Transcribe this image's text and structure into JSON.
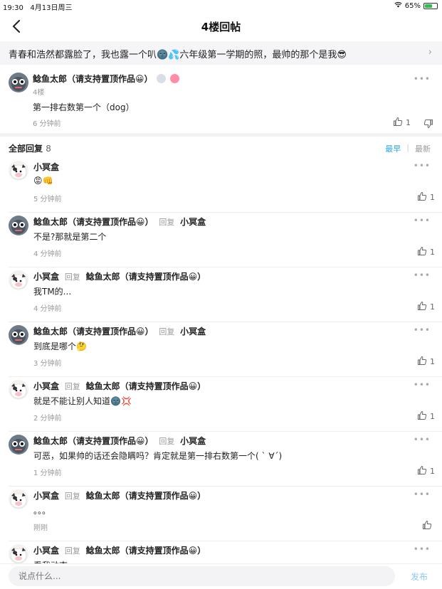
{
  "status": {
    "time": "19:30",
    "date": "4月13日周三",
    "battery_percent": "65%",
    "battery_level": 0.65
  },
  "nav": {
    "title": "4楼回帖"
  },
  "topic": {
    "text": "青春和浩然都露脸了，我也露一个叭🌚💦六年级第一学期的照，最帅的那个是我😎"
  },
  "post": {
    "author": "鲶鱼太郎（请支持置顶作品😀）",
    "floor": "4楼",
    "body": "第一排右数第一个（dog）",
    "time": "6 分钟前",
    "likes": "1"
  },
  "replies_header": {
    "title": "全部回复",
    "count": "8",
    "sort_earliest": "最早",
    "sort_latest": "最新"
  },
  "reply_word": "回复",
  "replies": [
    {
      "author": "小冥盒",
      "target": "",
      "text": "😡👊",
      "time": "5 分钟前",
      "likes": "1",
      "avatar": "cow"
    },
    {
      "author": "鲶鱼太郎（请支持置顶作品😀）",
      "target": "小冥盒",
      "text": "不是?那就是第二个",
      "time": "4 分钟前",
      "likes": "1",
      "avatar": "gray"
    },
    {
      "author": "小冥盒",
      "target": "鲶鱼太郎（请支持置顶作品😀）",
      "text": "我TM的...",
      "time": "4 分钟前",
      "likes": "1",
      "avatar": "cow"
    },
    {
      "author": "鲶鱼太郎（请支持置顶作品😀）",
      "target": "小冥盒",
      "text": "到底是哪个🤔",
      "time": "3 分钟前",
      "likes": "1",
      "avatar": "gray"
    },
    {
      "author": "小冥盒",
      "target": "鲶鱼太郎（请支持置顶作品😀）",
      "text": "就是不能让别人知道🌚💢",
      "time": "2 分钟前",
      "likes": "1",
      "avatar": "cow"
    },
    {
      "author": "鲶鱼太郎（请支持置顶作品😀）",
      "target": "小冥盒",
      "text": "可恶，如果帅的话还会隐瞒吗？肯定就是第一排右数第一个( ` ∀´)",
      "time": "1 分钟前",
      "likes": "1",
      "avatar": "gray"
    },
    {
      "author": "小冥盒",
      "target": "鲶鱼太郎（请支持置顶作品😀）",
      "text": "。。。",
      "time": "刚刚",
      "likes": "",
      "avatar": "cow"
    },
    {
      "author": "小冥盒",
      "target": "鲶鱼太郎（请支持置顶作品😀）",
      "text": "看我动态",
      "time": "",
      "likes": "",
      "avatar": "cow"
    }
  ],
  "bottom": {
    "placeholder": "说点什么...",
    "publish": "发布"
  },
  "colors": {
    "accent": "#2aa5e6",
    "publish": "#8cc8ef"
  }
}
